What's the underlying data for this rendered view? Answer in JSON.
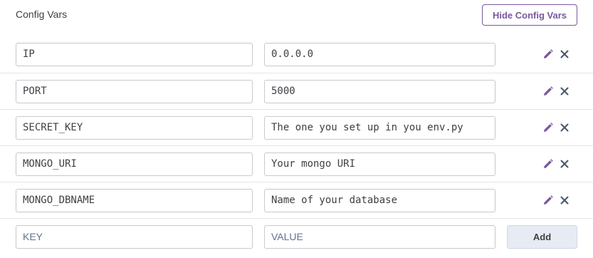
{
  "header": {
    "title": "Config Vars",
    "hide_button_label": "Hide Config Vars"
  },
  "config_vars": [
    {
      "key": "IP",
      "value": "0.0.0.0"
    },
    {
      "key": "PORT",
      "value": "5000"
    },
    {
      "key": "SECRET_KEY",
      "value": "The one you set up in you env.py"
    },
    {
      "key": "MONGO_URI",
      "value": "Your mongo URI"
    },
    {
      "key": "MONGO_DBNAME",
      "value": "Name of your database"
    }
  ],
  "new_var": {
    "key_placeholder": "KEY",
    "value_placeholder": "VALUE",
    "add_label": "Add"
  },
  "icons": {
    "edit": "pencil-icon",
    "remove": "close-icon"
  },
  "colors": {
    "accent": "#79589f",
    "text": "#3f3f44",
    "icon": "#475569",
    "add_bg": "#e7ebf3"
  }
}
